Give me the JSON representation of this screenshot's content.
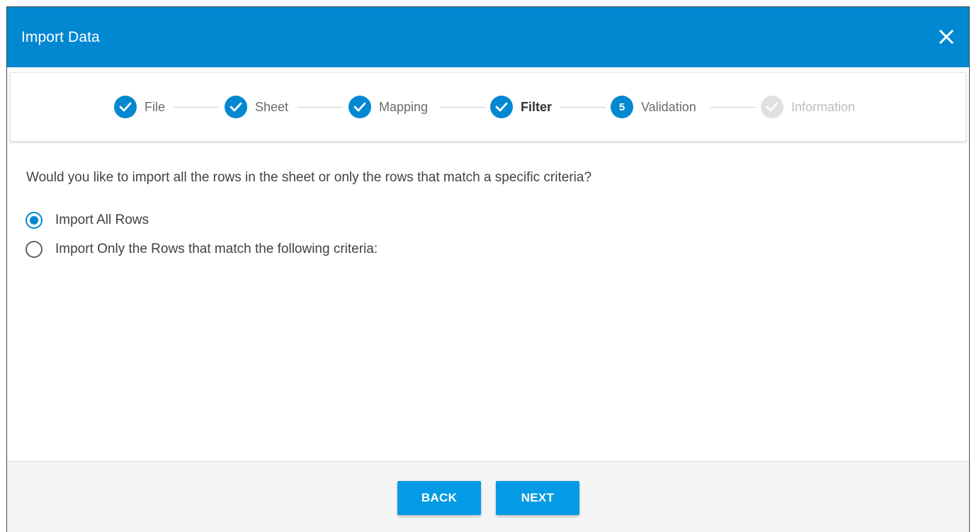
{
  "dialog": {
    "title": "Import Data",
    "close_icon": "close-icon"
  },
  "stepper": {
    "steps": [
      {
        "label": "File",
        "state": "done",
        "icon": "check-icon"
      },
      {
        "label": "Sheet",
        "state": "done",
        "icon": "check-icon"
      },
      {
        "label": "Mapping",
        "state": "done",
        "icon": "check-icon"
      },
      {
        "label": "Filter",
        "state": "done",
        "icon": "check-icon"
      },
      {
        "label": "Validation",
        "state": "active",
        "number": "5"
      },
      {
        "label": "Information",
        "state": "pending",
        "icon": "check-icon"
      }
    ]
  },
  "content": {
    "question": "Would you like to import all the rows in the sheet or only the rows that match a specific criteria?",
    "options": [
      {
        "label": "Import All Rows",
        "checked": true
      },
      {
        "label": "Import Only the Rows that match the following criteria:",
        "checked": false
      }
    ]
  },
  "footer": {
    "back_label": "BACK",
    "next_label": "NEXT"
  },
  "colors": {
    "header": "#0288d1",
    "accent": "#0288d1",
    "button": "#039be5",
    "pending_step": "#e0e0e0"
  }
}
